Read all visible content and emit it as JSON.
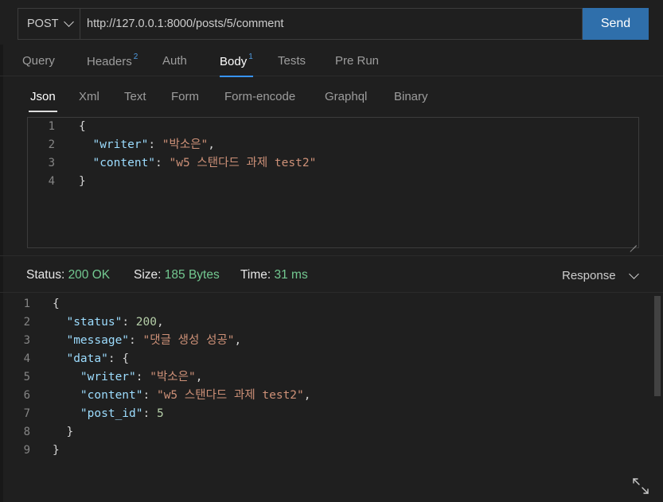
{
  "request": {
    "method": "POST",
    "url": "http://127.0.0.1:8000/posts/5/comment",
    "send_label": "Send"
  },
  "tabs": [
    {
      "label": "Query",
      "badge": ""
    },
    {
      "label": "Headers",
      "badge": "2"
    },
    {
      "label": "Auth",
      "badge": ""
    },
    {
      "label": "Body",
      "badge": "1"
    },
    {
      "label": "Tests",
      "badge": ""
    },
    {
      "label": "Pre Run",
      "badge": ""
    }
  ],
  "active_tab": "Body",
  "body_types": [
    "Json",
    "Xml",
    "Text",
    "Form",
    "Form-encode",
    "Graphql",
    "Binary"
  ],
  "active_body_type": "Json",
  "request_body": {
    "line_numbers": [
      "1",
      "2",
      "3",
      "4"
    ],
    "writer_key": "\"writer\"",
    "writer_value": "\"박소은\"",
    "content_key": "\"content\"",
    "content_value": "\"w5 스탠다드 과제 test2\""
  },
  "response_status": {
    "status_label": "Status:",
    "status_value": "200 OK",
    "size_label": "Size:",
    "size_value": "185 Bytes",
    "time_label": "Time:",
    "time_value": "31 ms",
    "view_label": "Response"
  },
  "response_body": {
    "line_numbers": [
      "1",
      "2",
      "3",
      "4",
      "5",
      "6",
      "7",
      "8",
      "9"
    ],
    "status_key": "\"status\"",
    "status_value": "200",
    "message_key": "\"message\"",
    "message_value": "\"댓글 생성 성공\"",
    "data_key": "\"data\"",
    "writer_key": "\"writer\"",
    "writer_value": "\"박소은\"",
    "content_key": "\"content\"",
    "content_value": "\"w5 스탠다드 과제 test2\"",
    "post_id_key": "\"post_id\"",
    "post_id_value": "5"
  },
  "colors": {
    "accent": "#3794ff",
    "send_button": "#2f6fab",
    "status_ok": "#73c991",
    "json_key": "#9cdcfe",
    "json_string": "#ce9178",
    "json_number": "#b5cea8"
  },
  "icons": [
    "chevron-down-icon",
    "resize-grip-icon",
    "expand-icon"
  ]
}
